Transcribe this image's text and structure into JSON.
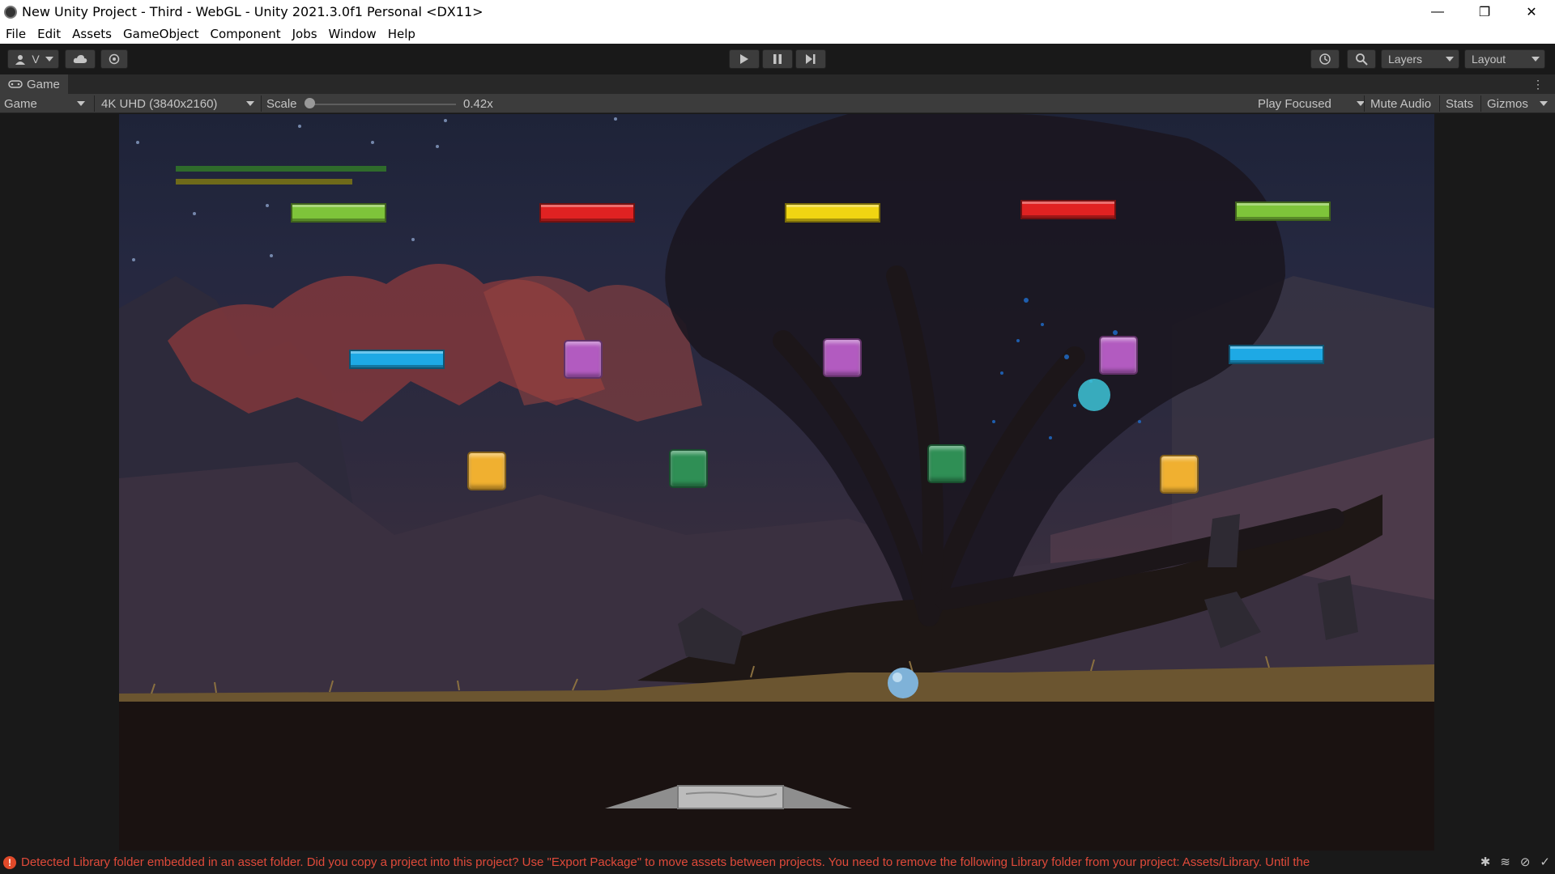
{
  "window": {
    "title": "New Unity Project - Third - WebGL - Unity 2021.3.0f1 Personal <DX11>",
    "minimize_glyph": "—",
    "maximize_glyph": "❐",
    "close_glyph": "✕"
  },
  "menu": [
    "File",
    "Edit",
    "Assets",
    "GameObject",
    "Component",
    "Jobs",
    "Window",
    "Help"
  ],
  "toolbar": {
    "account_label": "V",
    "layers_label": "Layers",
    "layout_label": "Layout"
  },
  "game_tab": {
    "label": "Game",
    "more_glyph": "⋮"
  },
  "game_view": {
    "display_mode": "Game",
    "resolution": "4K UHD (3840x2160)",
    "scale_label": "Scale",
    "scale_value": "0.42x",
    "scale_fraction": 0.0,
    "play_mode": "Play Focused",
    "mute_audio": "Mute Audio",
    "stats": "Stats",
    "gizmos": "Gizmos"
  },
  "game": {
    "hud_bars": [
      "#2f6b2b",
      "#6f6a1a"
    ],
    "bricks": [
      {
        "kind": "bar",
        "color": "#7ec43a"
      },
      {
        "kind": "bar",
        "color": "#e02222"
      },
      {
        "kind": "bar",
        "color": "#f0d512"
      },
      {
        "kind": "bar",
        "color": "#e02222"
      },
      {
        "kind": "bar",
        "color": "#7ec43a"
      },
      {
        "kind": "bar",
        "color": "#1ea9e5"
      },
      {
        "kind": "bar",
        "color": "#1ea9e5"
      },
      {
        "kind": "block",
        "color": "#b25bc0"
      },
      {
        "kind": "block",
        "color": "#b25bc0"
      },
      {
        "kind": "block",
        "color": "#b25bc0"
      },
      {
        "kind": "block",
        "color": "#f0b030"
      },
      {
        "kind": "block",
        "color": "#f0b030"
      },
      {
        "kind": "block",
        "color": "#2f8f55"
      },
      {
        "kind": "block",
        "color": "#2f8f55"
      }
    ],
    "ball_color": "#7fb2d8",
    "powerup_color": "#3dc6d8"
  },
  "status": {
    "message": "Detected Library folder embedded in an asset folder. Did you copy a project into this project? Use \"Export Package\" to move assets between projects. You need to remove the following Library folder from your project: Assets/Library. Until the"
  }
}
